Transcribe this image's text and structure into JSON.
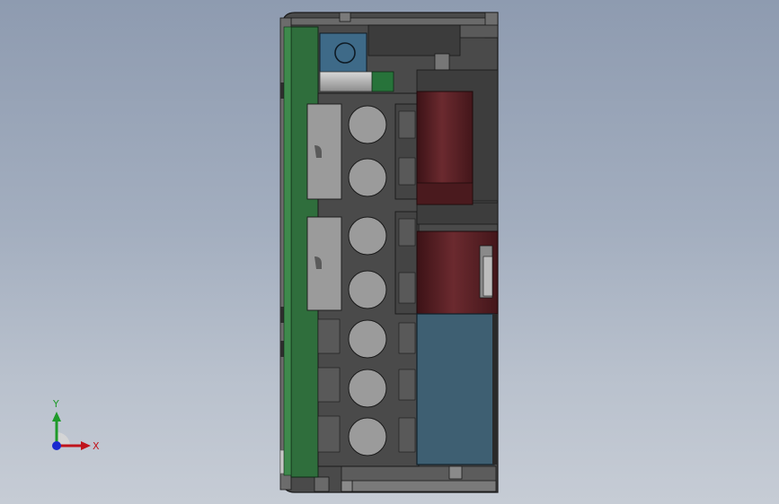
{
  "triad": {
    "x_label": "X",
    "y_label": "Y",
    "x_color": "#c0141c",
    "y_color": "#1f9a2a",
    "z_color": "#1a2ad0"
  },
  "colors": {
    "background_top": "#8e9bb0",
    "background_bottom": "#c6ccd5",
    "housing": "#404040",
    "pcb": "#2f6e3c",
    "terminal_block": "#9b9b9b",
    "capacitor": "#5a1e22",
    "relay": "#3e5f72",
    "nut": "#3e6a88"
  },
  "model": {
    "description_name": "cad-model-front-view",
    "terminal_count": 7
  }
}
